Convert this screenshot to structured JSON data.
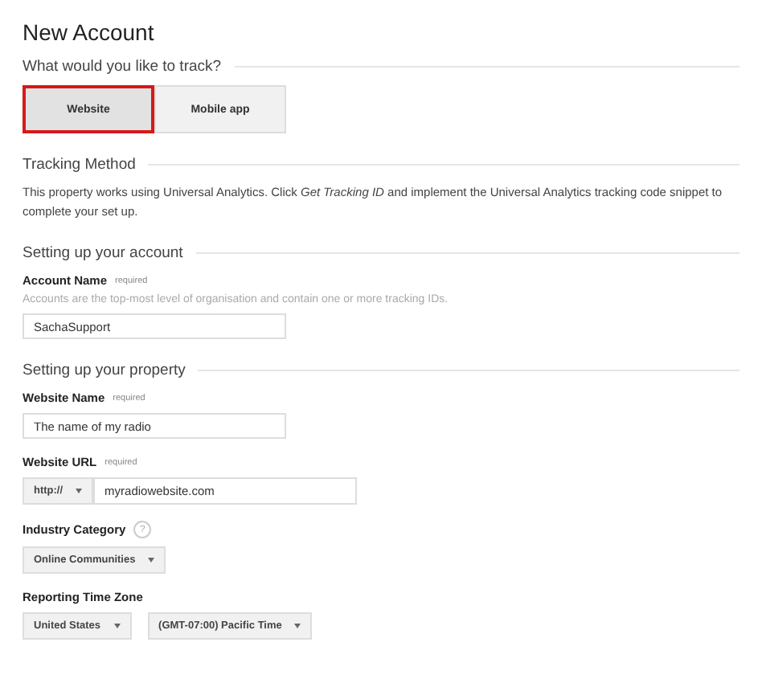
{
  "title": "New Account",
  "track": {
    "heading": "What would you like to track?",
    "options": [
      {
        "label": "Website",
        "selected": true
      },
      {
        "label": "Mobile app",
        "selected": false
      }
    ]
  },
  "tracking_method": {
    "heading": "Tracking Method",
    "text": "This property works using Universal Analytics. Click *Get Tracking ID* and implement the Universal Analytics tracking code snippet to complete your set up."
  },
  "account": {
    "heading": "Setting up your account",
    "account_name": {
      "label": "Account Name",
      "required": "required",
      "hint": "Accounts are the top-most level of organisation and contain one or more tracking IDs.",
      "value": "SachaSupport"
    }
  },
  "property": {
    "heading": "Setting up your property",
    "website_name": {
      "label": "Website Name",
      "required": "required",
      "value": "The name of my radio"
    },
    "website_url": {
      "label": "Website URL",
      "required": "required",
      "protocol": "http://",
      "value": "myradiowebsite.com"
    },
    "industry": {
      "label": "Industry Category",
      "help": "?",
      "value": "Online Communities"
    },
    "timezone": {
      "label": "Reporting Time Zone",
      "country": "United States",
      "zone": "(GMT-07:00) Pacific Time"
    }
  }
}
